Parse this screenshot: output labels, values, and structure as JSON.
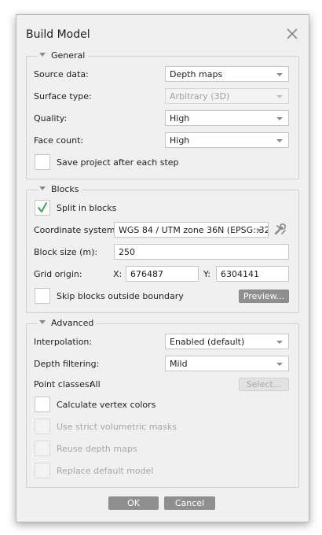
{
  "dialog": {
    "title": "Build Model"
  },
  "general": {
    "legend": "General",
    "source_data": {
      "label": "Source data:",
      "value": "Depth maps"
    },
    "surface_type": {
      "label": "Surface type:",
      "value": "Arbitrary (3D)"
    },
    "quality": {
      "label": "Quality:",
      "value": "High"
    },
    "face_count": {
      "label": "Face count:",
      "value": "High"
    },
    "save_project": {
      "label": "Save project after each step",
      "checked": false
    }
  },
  "blocks": {
    "legend": "Blocks",
    "split_in_blocks": {
      "label": "Split in blocks",
      "checked": true
    },
    "coordinate_system": {
      "label": "Coordinate system:",
      "value": "WGS 84 / UTM zone 36N (EPSG::32"
    },
    "block_size": {
      "label": "Block size (m):",
      "value": "250"
    },
    "grid_origin": {
      "label": "Grid origin:",
      "x_label": "X:",
      "x_value": "676487",
      "y_label": "Y:",
      "y_value": "6304141"
    },
    "skip_blocks": {
      "label": "Skip blocks outside boundary",
      "checked": false
    },
    "preview_button": "Preview..."
  },
  "advanced": {
    "legend": "Advanced",
    "interpolation": {
      "label": "Interpolation:",
      "value": "Enabled (default)"
    },
    "depth_filtering": {
      "label": "Depth filtering:",
      "value": "Mild"
    },
    "point_classes": {
      "label": "Point classes:",
      "value": "All",
      "select_button": "Select..."
    },
    "calculate_vertex_colors": {
      "label": "Calculate vertex colors",
      "checked": false
    },
    "strict_volumetric_masks": {
      "label": "Use strict volumetric masks",
      "checked": false,
      "enabled": false
    },
    "reuse_depth_maps": {
      "label": "Reuse depth maps",
      "checked": false,
      "enabled": false
    },
    "replace_default_model": {
      "label": "Replace default model",
      "checked": false,
      "enabled": false
    }
  },
  "footer": {
    "ok": "OK",
    "cancel": "Cancel"
  },
  "colors": {
    "checkmark": "#3aa55a",
    "button": "#8f8f8f",
    "background": "#f0f0f0"
  }
}
